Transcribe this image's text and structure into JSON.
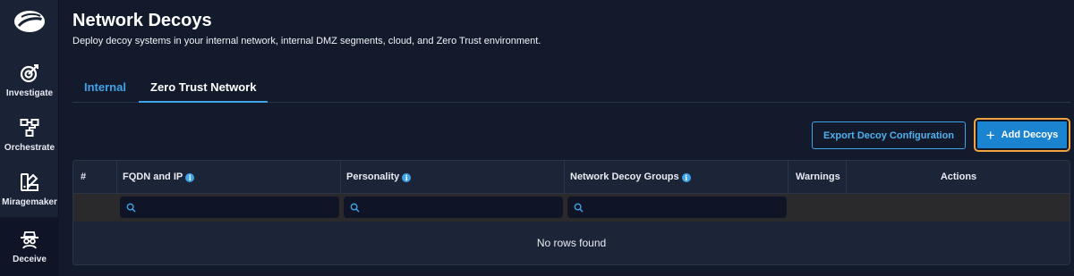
{
  "sidebar": {
    "logo_icon": "zscaler-cloud-logo",
    "items": [
      {
        "label": "Investigate",
        "icon": "target-icon"
      },
      {
        "label": "Orchestrate",
        "icon": "workflow-icon"
      },
      {
        "label": "Miragemaker",
        "icon": "miragemaker-icon"
      },
      {
        "label": "Deceive",
        "icon": "spy-icon",
        "active": true
      }
    ]
  },
  "header": {
    "title": "Network Decoys",
    "subtitle": "Deploy decoy systems in your internal network, internal DMZ segments, cloud, and Zero Trust environment."
  },
  "tabs": [
    {
      "label": "Internal",
      "active": false
    },
    {
      "label": "Zero Trust Network",
      "active": true
    }
  ],
  "toolbar": {
    "export_label": "Export Decoy Configuration",
    "add_label": "Add Decoys",
    "add_icon": "plus-icon"
  },
  "table": {
    "columns": [
      "#",
      "FQDN and IP",
      "Personality",
      "Network Decoy Groups",
      "Warnings",
      "Actions"
    ],
    "filters": [
      {
        "column": "FQDN and IP",
        "value": "",
        "placeholder": ""
      },
      {
        "column": "Personality",
        "value": "",
        "placeholder": ""
      },
      {
        "column": "Network Decoy Groups",
        "value": "",
        "placeholder": ""
      }
    ],
    "empty_message": "No rows found"
  },
  "colors": {
    "background": "#131a2c",
    "sidebar": "#1a2236",
    "accent": "#3ea3e8",
    "primary_button": "#1b84d1",
    "focus_ring": "#f0a342"
  }
}
